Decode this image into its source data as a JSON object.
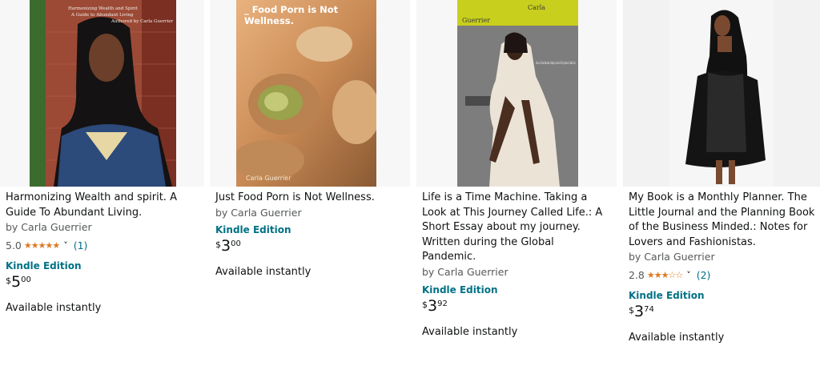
{
  "products": [
    {
      "title": "Harmonizing Wealth and spirit. A Guide To Abundant Living.",
      "byline": "by Carla Guerrier",
      "rating": "5.0",
      "stars": "★★★★★",
      "review_count": "(1)",
      "format": "Kindle Edition",
      "price_symbol": "$",
      "price_whole": "5",
      "price_fraction": "00",
      "availability": "Available instantly",
      "cover_text": [
        "Harmonizing Wealth and Spirit",
        "A Guide to Abundant Living",
        "Authored by Carla Guerrier"
      ]
    },
    {
      "title": "Just Food Porn is Not Wellness.",
      "byline": "by Carla Guerrier",
      "format": "Kindle Edition",
      "price_symbol": "$",
      "price_whole": "3",
      "price_fraction": "00",
      "availability": "Available instantly",
      "cover_text": [
        "_ Food Porn is Not",
        "Wellness.",
        "Carla Guerrier"
      ]
    },
    {
      "title": "Life is a Time Machine. Taking a Look at This Journey Called Life.: A Short Essay about my journey. Written during the Global Pandemic.",
      "byline": "by Carla Guerrier",
      "format": "Kindle Edition",
      "price_symbol": "$",
      "price_whole": "3",
      "price_fraction": "92",
      "availability": "Available instantly",
      "cover_text": [
        "Carla",
        "Guerrier",
        "Life is a Time Machine. Taking a Look at This Journey Called Life."
      ]
    },
    {
      "title": "My Book is a Monthly Planner. The Little Journal and the Planning Book of the Business Minded.: Notes for Lovers and Fashionistas.",
      "byline": "by Carla Guerrier",
      "rating": "2.8",
      "stars": "★★★☆☆",
      "review_count": "(2)",
      "format": "Kindle Edition",
      "price_symbol": "$",
      "price_whole": "3",
      "price_fraction": "74",
      "availability": "Available instantly"
    }
  ],
  "colors": {
    "link": "#007185",
    "star": "#de7921",
    "text": "#0f1111",
    "muted": "#565959"
  }
}
